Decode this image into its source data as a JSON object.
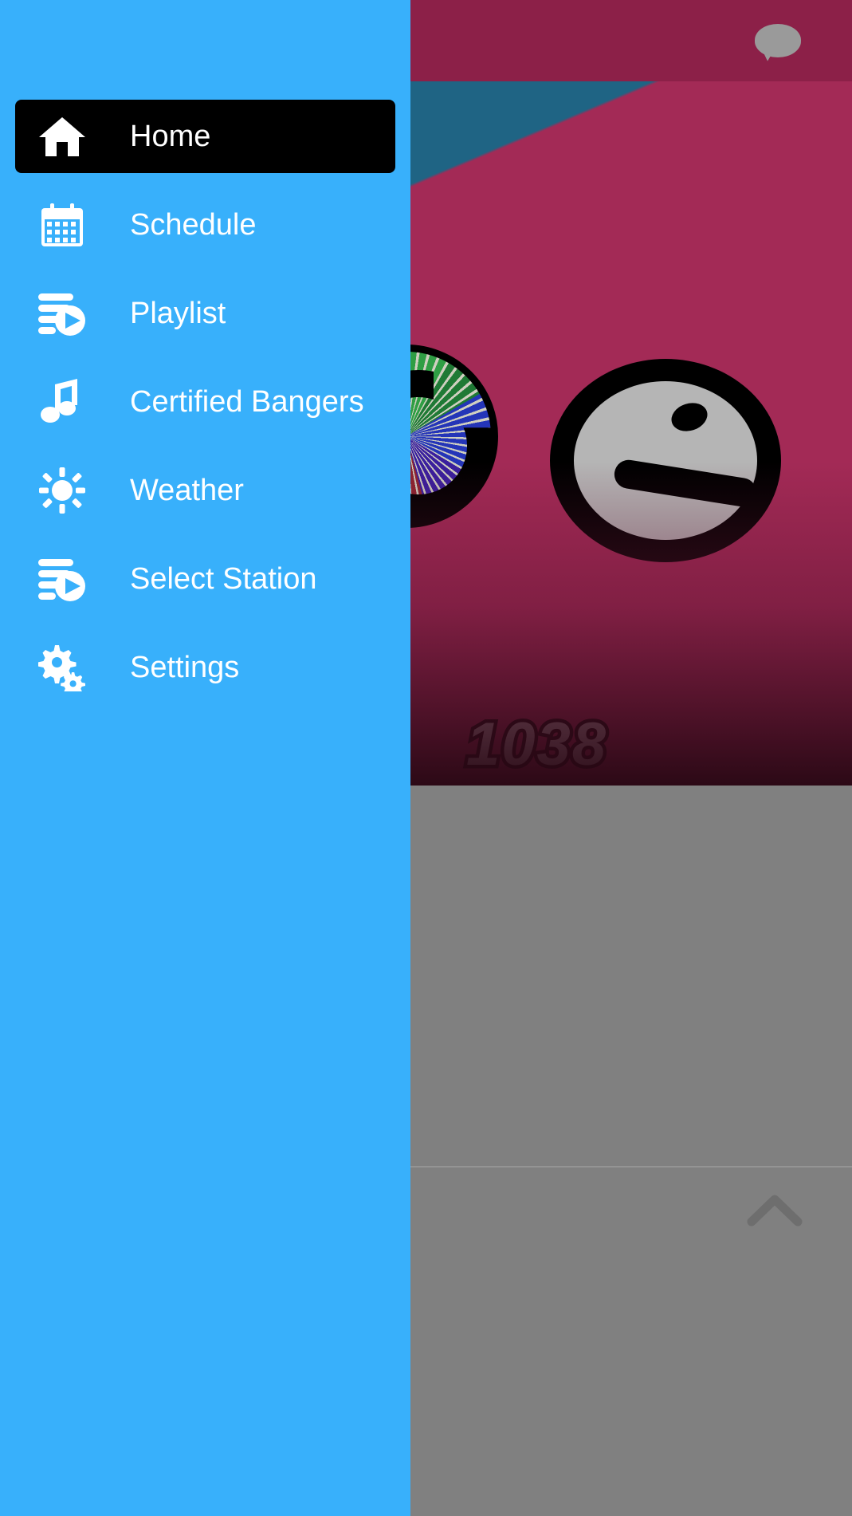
{
  "app": {
    "background_color": "#808080"
  },
  "topbar": {
    "background_color": "#8c2048",
    "chat_icon": "chat-bubble-icon"
  },
  "hero": {
    "teal_color": "#1f6484",
    "maroon_color": "#a32a56",
    "station_frequency": "1038",
    "logo_letter": "e",
    "wheel_icon": "color-wheel-icon"
  },
  "body": {
    "background_color": "#808080",
    "scroll_top_icon": "chevron-up-icon"
  },
  "drawer": {
    "background_color": "#38b0fb",
    "active_item_color": "#000000",
    "text_color": "#ffffff",
    "items": [
      {
        "label": "Home",
        "icon": "home-icon",
        "active": true
      },
      {
        "label": "Schedule",
        "icon": "calendar-icon",
        "active": false
      },
      {
        "label": "Playlist",
        "icon": "playlist-icon",
        "active": false
      },
      {
        "label": "Certified Bangers",
        "icon": "music-note-icon",
        "active": false
      },
      {
        "label": "Weather",
        "icon": "sun-icon",
        "active": false
      },
      {
        "label": "Select Station",
        "icon": "playlist-icon",
        "active": false
      },
      {
        "label": "Settings",
        "icon": "gears-icon",
        "active": false
      }
    ]
  }
}
